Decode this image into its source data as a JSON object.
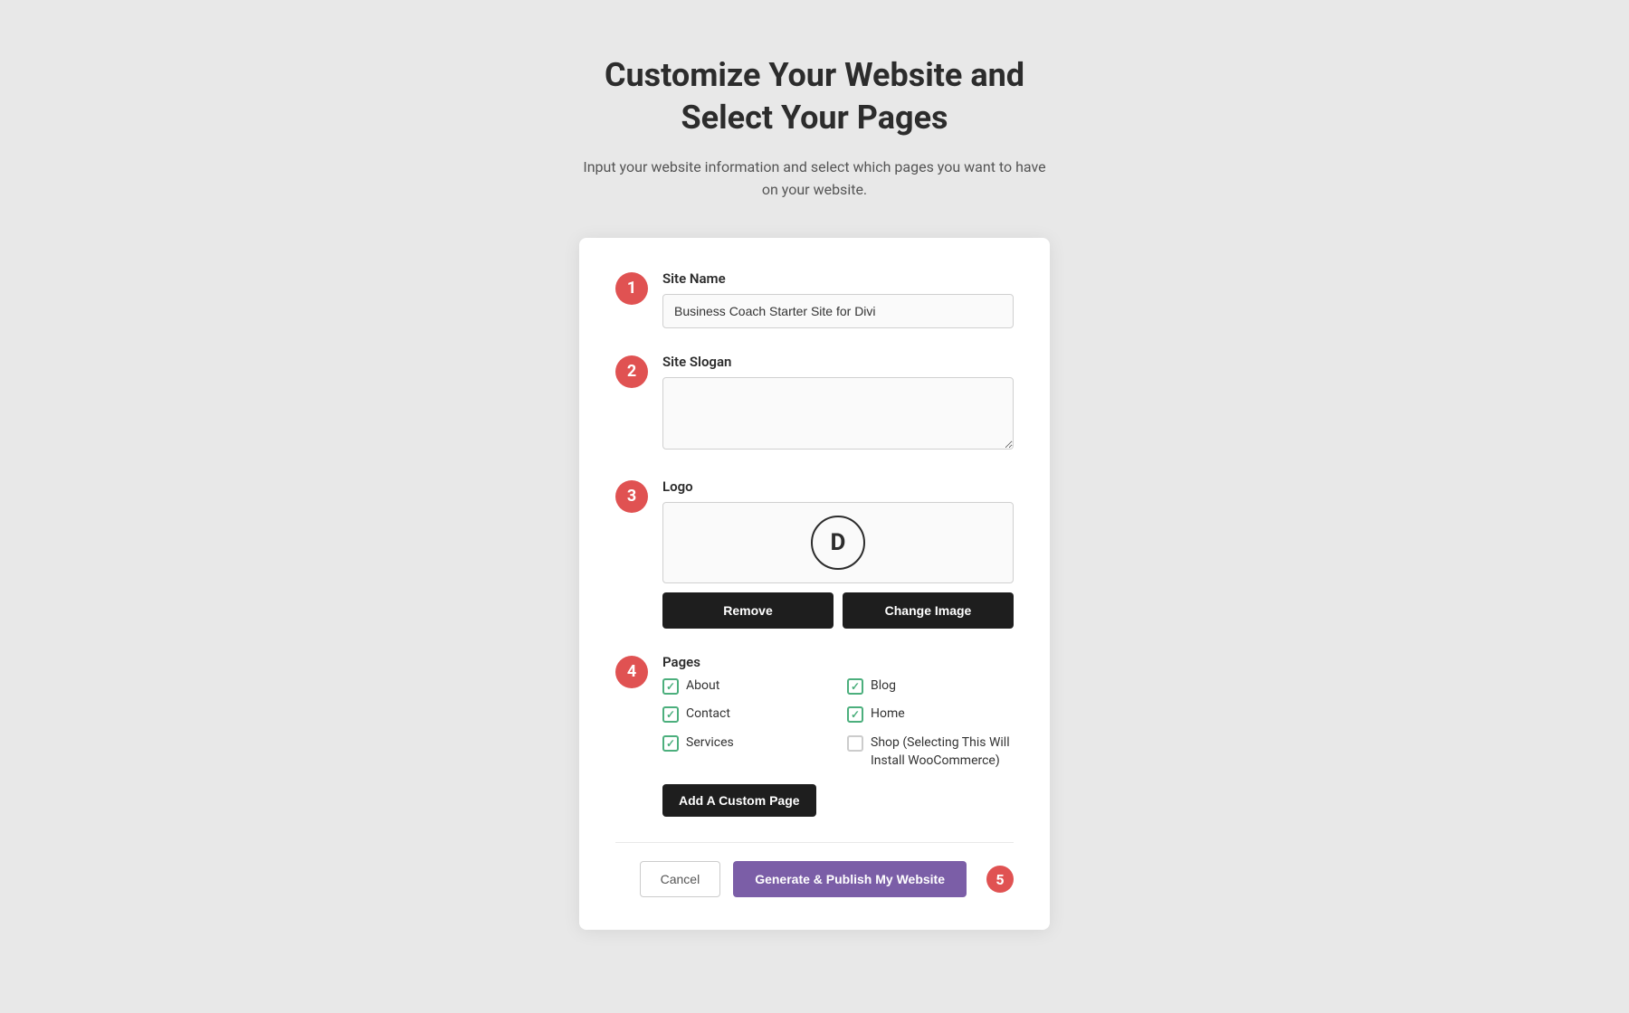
{
  "header": {
    "title_line1": "Customize Your Website and",
    "title_line2": "Select Your Pages",
    "subtitle": "Input your website information and select which pages you want to have on your website."
  },
  "steps": {
    "step1": {
      "number": "1",
      "label": "Site Name",
      "value": "Business Coach Starter Site for Divi",
      "placeholder": "Business Coach Starter Site for Divi"
    },
    "step2": {
      "number": "2",
      "label": "Site Slogan",
      "value": "",
      "placeholder": ""
    },
    "step3": {
      "number": "3",
      "label": "Logo",
      "logo_letter": "D",
      "remove_btn": "Remove",
      "change_btn": "Change Image"
    },
    "step4": {
      "number": "4",
      "label": "Pages",
      "pages": [
        {
          "id": "about",
          "label": "About",
          "checked": true,
          "col": 0
        },
        {
          "id": "blog",
          "label": "Blog",
          "checked": true,
          "col": 1
        },
        {
          "id": "contact",
          "label": "Contact",
          "checked": true,
          "col": 0
        },
        {
          "id": "home",
          "label": "Home",
          "checked": true,
          "col": 1
        },
        {
          "id": "services",
          "label": "Services",
          "checked": true,
          "col": 0
        },
        {
          "id": "shop",
          "label": "Shop (Selecting This Will Install WooCommerce)",
          "checked": false,
          "col": 1
        }
      ],
      "add_custom_btn": "Add A Custom Page"
    }
  },
  "footer": {
    "cancel_label": "Cancel",
    "publish_label": "Generate & Publish My Website",
    "step_number": "5"
  }
}
